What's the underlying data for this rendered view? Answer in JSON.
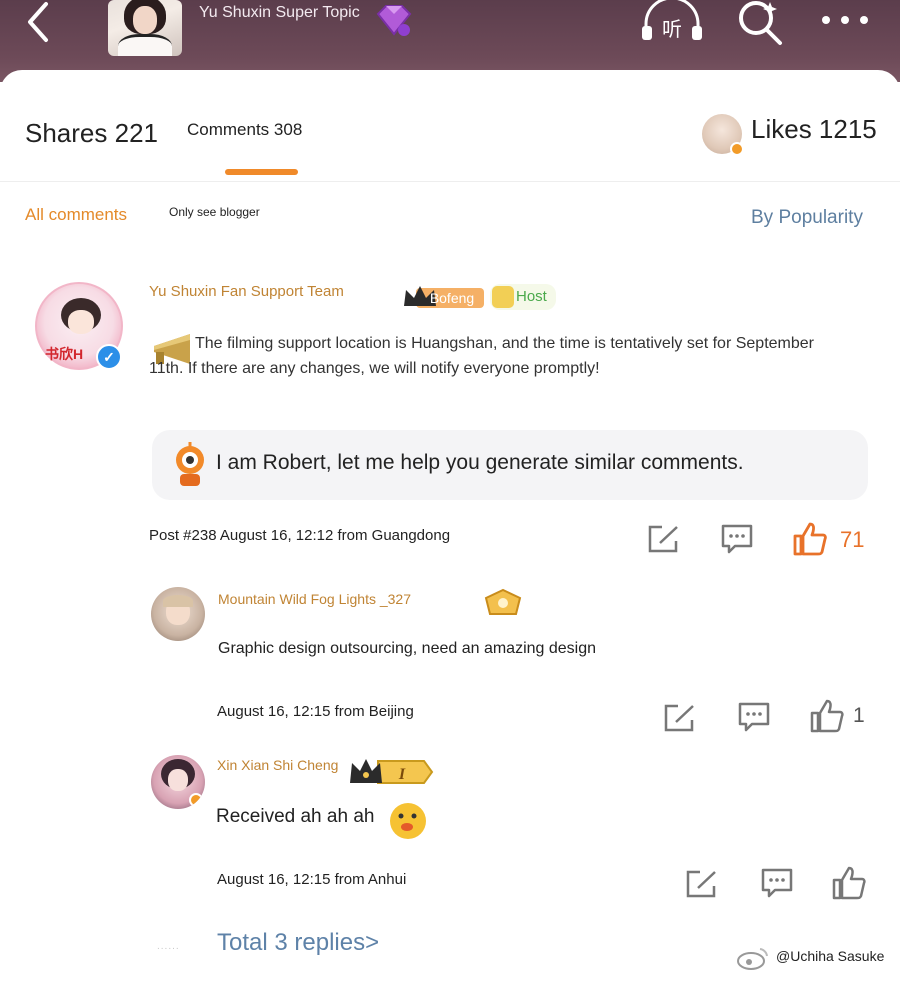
{
  "header": {
    "topic_title": "Yu Shuxin Super Topic",
    "listen_icon_label": "听",
    "icons": [
      "back-arrow-icon",
      "listen-icon",
      "search-sparkle-icon",
      "more-dots-icon",
      "purple-gem-icon"
    ]
  },
  "tabs": {
    "shares": "Shares 221",
    "comments": "Comments 308",
    "likes": "Likes 1215"
  },
  "filters": {
    "all": "All comments",
    "blogger": "Only see blogger",
    "sort": "By Popularity"
  },
  "main_comment": {
    "avatar_text": "书欣H",
    "author": "Yu Shuxin Fan Support Team",
    "badge_label": "Bofeng",
    "host_label": "Host",
    "text": "The filming support location is Huangshan, and the time is tentatively set for September 11th. If there are any changes, we will notify everyone promptly!",
    "ai_prompt": "I am Robert, let me help you generate similar comments.",
    "meta": "Post #238 August 16, 12:12 from Guangdong",
    "likes": "71"
  },
  "replies": [
    {
      "author": "Mountain Wild Fog Lights _327",
      "text": "Graphic design outsourcing, need an amazing design",
      "meta": "August 16, 12:15 from Beijing",
      "likes": "1"
    },
    {
      "author": "Xin Xian Shi Cheng",
      "level_badge": "I",
      "text": "Received ah ah ah",
      "meta": "August 16, 12:15 from Anhui",
      "likes": ""
    }
  ],
  "footer": {
    "dots": "......",
    "total_replies": "Total 3 replies>",
    "watermark": "@Uchiha Sasuke"
  },
  "colors": {
    "accent_orange": "#f08a2a",
    "link_blue": "#5e82a8",
    "name_gold": "#c08434",
    "header_bg": "#5b3d4c",
    "verified_blue": "#2c8fe8"
  }
}
